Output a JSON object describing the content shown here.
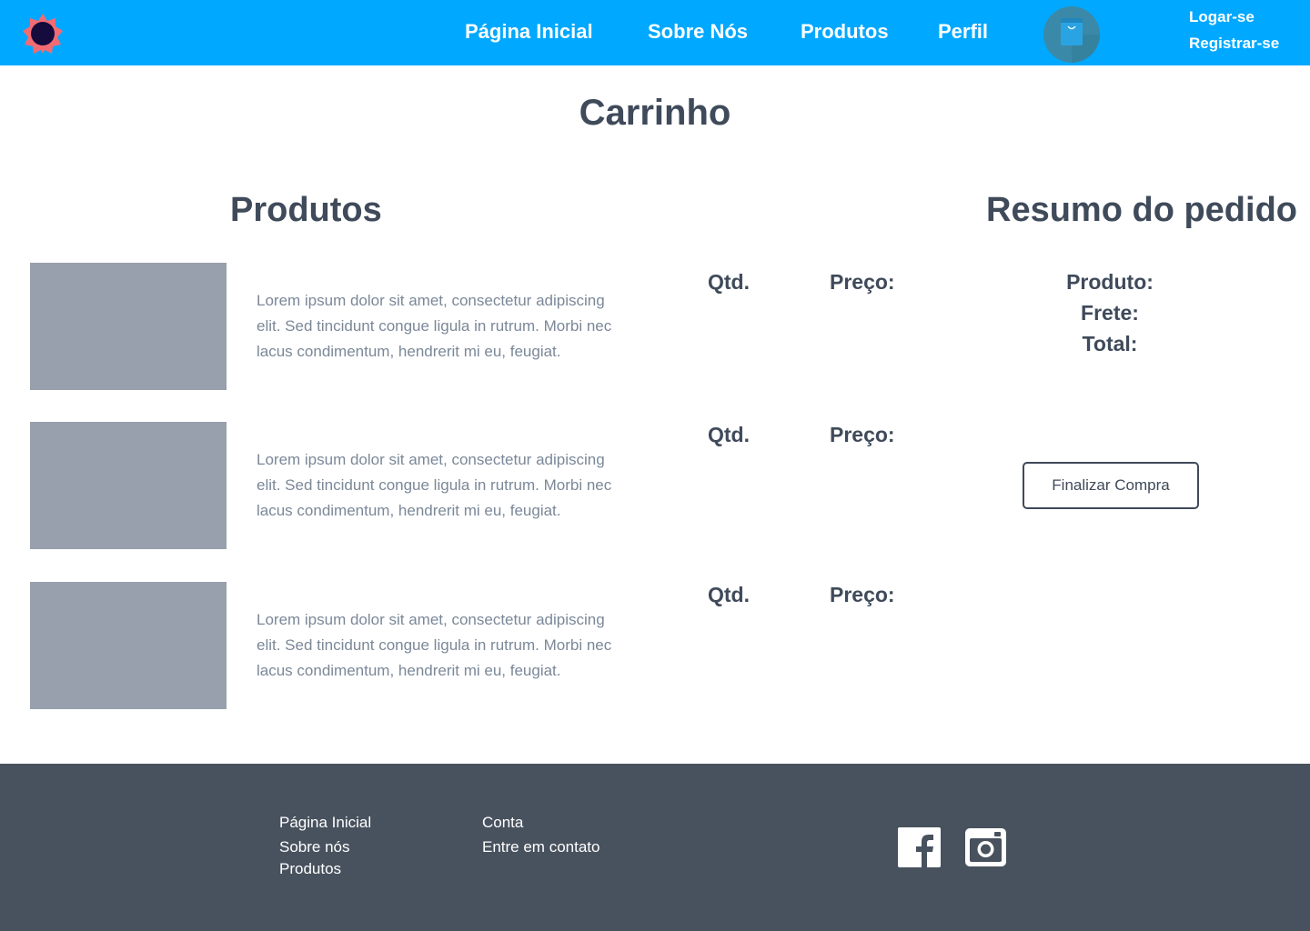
{
  "header": {
    "logo": "sun-logo",
    "nav": [
      {
        "label": "Página Inicial"
      },
      {
        "label": "Sobre Nós"
      },
      {
        "label": "Produtos"
      },
      {
        "label": "Perfil"
      }
    ],
    "cart_icon": "shopping-bag-icon",
    "login_label": "Logar-se",
    "register_label": "Registrar-se"
  },
  "main": {
    "page_title": "Carrinho",
    "products_title": "Produtos",
    "summary_title": "Resumo do pedido",
    "items": [
      {
        "description": "Lorem ipsum dolor sit amet, consectetur adipiscing elit. Sed tincidunt congue ligula in rutrum. Morbi nec lacus condimentum, hendrerit mi eu, feugiat.",
        "qty_label": "Qtd.",
        "price_label": "Preço:"
      },
      {
        "description": "Lorem ipsum dolor sit amet, consectetur adipiscing elit. Sed tincidunt congue ligula in rutrum. Morbi nec lacus condimentum, hendrerit mi eu, feugiat.",
        "qty_label": "Qtd.",
        "price_label": "Preço:"
      },
      {
        "description": "Lorem ipsum dolor sit amet, consectetur adipiscing elit. Sed tincidunt congue ligula in rutrum. Morbi nec lacus condimentum, hendrerit mi eu, feugiat.",
        "qty_label": "Qtd.",
        "price_label": "Preço:"
      }
    ],
    "summary": {
      "product_label": "Produto:",
      "shipping_label": "Frete:",
      "total_label": "Total:",
      "checkout_label": "Finalizar Compra"
    }
  },
  "footer": {
    "col1": [
      "Página Inicial",
      "Sobre nós",
      "Produtos"
    ],
    "col2": [
      "Conta",
      "Entre em contato"
    ],
    "social": [
      "facebook-icon",
      "instagram-icon"
    ]
  },
  "colors": {
    "header_bg": "#00a8ff",
    "footer_bg": "#48525e",
    "heading_text": "#3f4a5a",
    "body_text": "#7b8898",
    "image_placeholder": "#97a0ac"
  }
}
